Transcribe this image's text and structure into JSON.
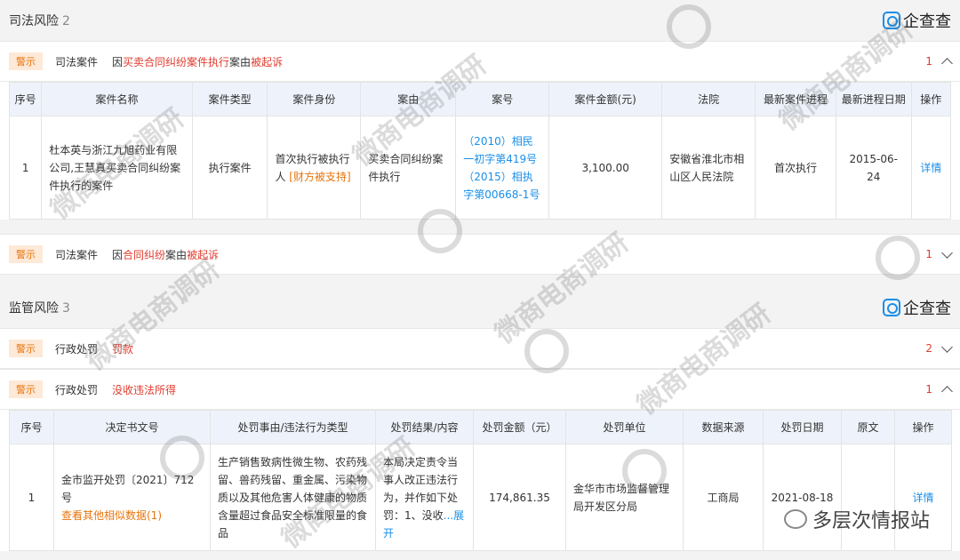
{
  "judicial": {
    "title": "司法风险",
    "count": "2",
    "brand": "企查查",
    "case1": {
      "tag": "警示",
      "type": "司法案件",
      "desc_pre": "因",
      "desc_hl": "买卖合同纠纷案件执行",
      "desc_mid": "案由",
      "desc_end": "被起诉",
      "count": "1"
    },
    "table": {
      "headers": [
        "序号",
        "案件名称",
        "案件类型",
        "案件身份",
        "案由",
        "案号",
        "案件金额(元)",
        "法院",
        "最新案件进程",
        "最新进程日期",
        "操作"
      ],
      "row": {
        "index": "1",
        "name": "杜本英与浙江九旭药业有限公司,王慧真买卖合同纠纷案件执行的案件",
        "type": "执行案件",
        "identity_pre": "首次执行被执行人",
        "identity_hl": "[财方被支持]",
        "cause": "买卖合同纠纷案件执行",
        "case_no": "（2010）相民一初字第419号（2015）相执字第00668-1号",
        "amount": "3,100.00",
        "court": "安徽省淮北市相山区人民法院",
        "progress": "首次执行",
        "date": "2015-06-24",
        "action": "详情"
      }
    },
    "case2": {
      "tag": "警示",
      "type": "司法案件",
      "desc_pre": "因",
      "desc_hl": "合同纠纷",
      "desc_mid": "案由",
      "desc_end": "被起诉",
      "count": "1"
    }
  },
  "regulatory": {
    "title": "监管风险",
    "count": "3",
    "brand": "企查查",
    "item1": {
      "tag": "警示",
      "type": "行政处罚",
      "desc": "罚款",
      "count": "2"
    },
    "item2": {
      "tag": "警示",
      "type": "行政处罚",
      "desc": "没收违法所得",
      "count": "1"
    },
    "table": {
      "headers": [
        "序号",
        "决定书文号",
        "处罚事由/违法行为类型",
        "处罚结果/内容",
        "处罚金额（元）",
        "处罚单位",
        "数据来源",
        "处罚日期",
        "原文",
        "操作"
      ],
      "row": {
        "index": "1",
        "doc_no": "金市监开处罚〔2021〕712号",
        "doc_more": "查看其他相似数据(1)",
        "reason": "生产销售致病性微生物、农药残留、兽药残留、重金属、污染物质以及其他危害人体健康的物质含量超过食品安全标准限量的食品",
        "result": "本局决定责令当事人改正违法行为，并作如下处罚：1、没收",
        "result_more": "...展开",
        "amount": "174,861.35",
        "unit": "金华市市场监督管理局开发区分局",
        "source": "工商局",
        "date": "2021-08-18",
        "original": "",
        "action": "详情"
      }
    }
  },
  "watermark": {
    "text": "微商电商调研",
    "footer": "多层次情报站"
  }
}
